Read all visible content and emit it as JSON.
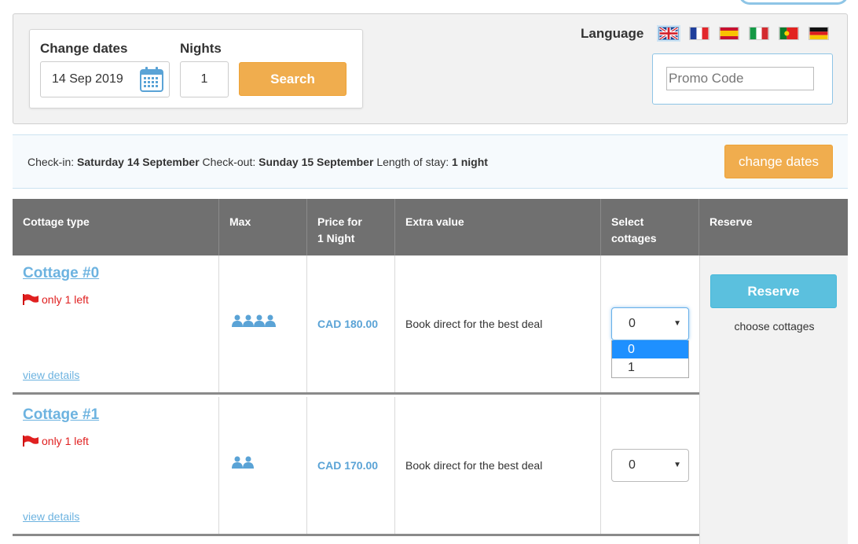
{
  "search": {
    "change_dates_label": "Change dates",
    "nights_label": "Nights",
    "date_value": "14 Sep 2019",
    "nights_value": "1",
    "search_button": "Search",
    "calendar_icon": "calendar-icon"
  },
  "language": {
    "label": "Language",
    "flags": [
      "uk-flag-icon",
      "france-flag-icon",
      "spain-flag-icon",
      "italy-flag-icon",
      "portugal-flag-icon",
      "germany-flag-icon"
    ]
  },
  "promo": {
    "placeholder": "Promo Code"
  },
  "stay": {
    "checkin_label": "Check-in:",
    "checkin_value": "Saturday 14 September",
    "checkout_label": "Check-out:",
    "checkout_value": "Sunday 15 September",
    "length_label": "Length of stay:",
    "length_value": "1 night",
    "change_button": "change dates"
  },
  "table": {
    "headers": {
      "type": "Cottage type",
      "max": "Max",
      "price_line1": "Price for",
      "price_line2": "1 Night",
      "extra": "Extra value",
      "select_line1": "Select",
      "select_line2": "cottages",
      "reserve": "Reserve"
    },
    "rows": [
      {
        "name": "Cottage #0",
        "availability": "only 1 left",
        "view": "view details",
        "max_guests": 4,
        "price": "CAD 180.00",
        "extra": "Book direct for the best deal",
        "selected": "0"
      },
      {
        "name": "Cottage #1",
        "availability": "only 1 left",
        "view": "view details",
        "max_guests": 2,
        "price": "CAD 170.00",
        "extra": "Book direct for the best deal",
        "selected": "0"
      }
    ],
    "dropdown_options": [
      "0",
      "1"
    ],
    "dropdown_highlighted": "0"
  },
  "reserve": {
    "button": "Reserve",
    "hint": "choose cottages"
  },
  "colors": {
    "accent_orange": "#f0ad4e",
    "accent_blue": "#5bc0de",
    "link_blue": "#6db3e0",
    "header_gray": "#707070",
    "alert_red": "#e02020"
  }
}
